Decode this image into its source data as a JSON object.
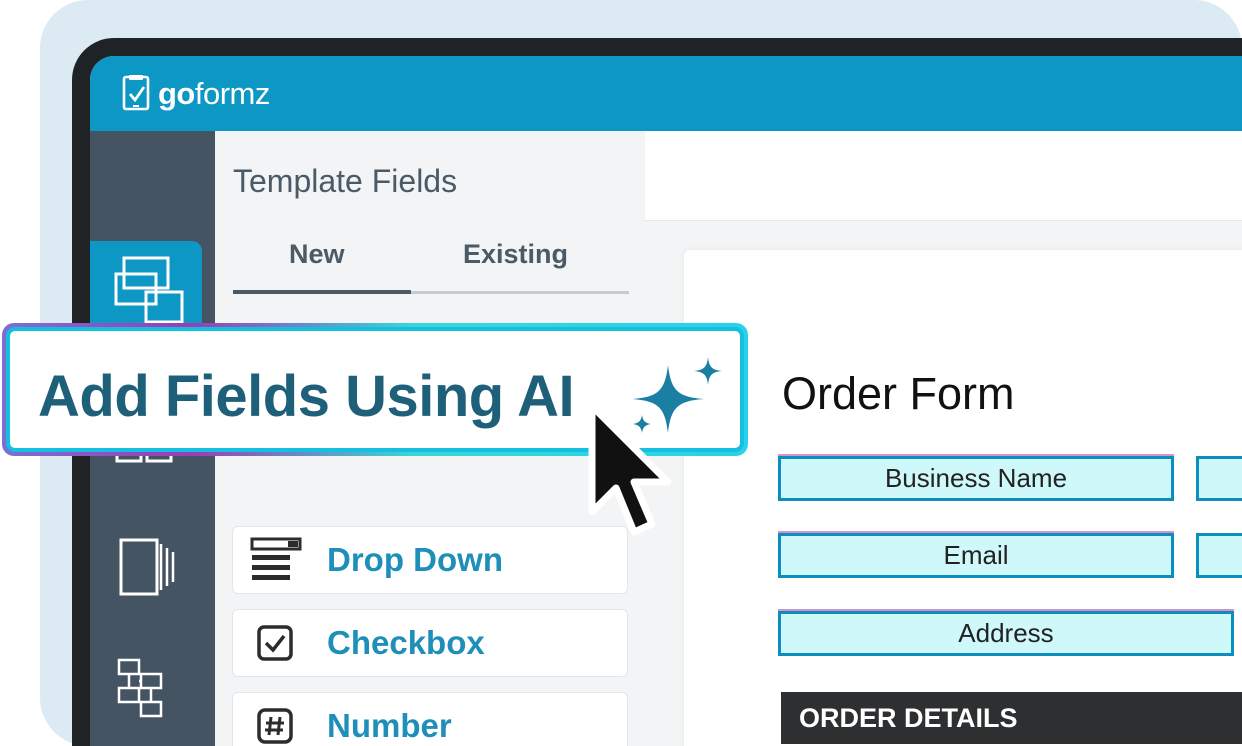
{
  "app": {
    "logo_bold": "go",
    "logo_light": "formz"
  },
  "panel": {
    "title": "Template Fields",
    "tabs": [
      {
        "label": "New",
        "active": true
      },
      {
        "label": "Existing",
        "active": false
      }
    ],
    "fields": [
      {
        "label": "Drop Down",
        "icon": "dropdown-icon"
      },
      {
        "label": "Checkbox",
        "icon": "checkbox-icon"
      },
      {
        "label": "Number",
        "icon": "number-icon"
      }
    ]
  },
  "ai_banner": {
    "label": "Add Fields Using AI",
    "icon": "sparkle-icon"
  },
  "form": {
    "title": "Order Form",
    "fields": [
      "Business Name",
      "Email",
      "Address"
    ],
    "section": "ORDER DETAILS"
  },
  "colors": {
    "brand": "#0c97c4",
    "rail": "#445462",
    "field_fill": "#cff8fb",
    "ai_text": "#1e5f7a"
  }
}
